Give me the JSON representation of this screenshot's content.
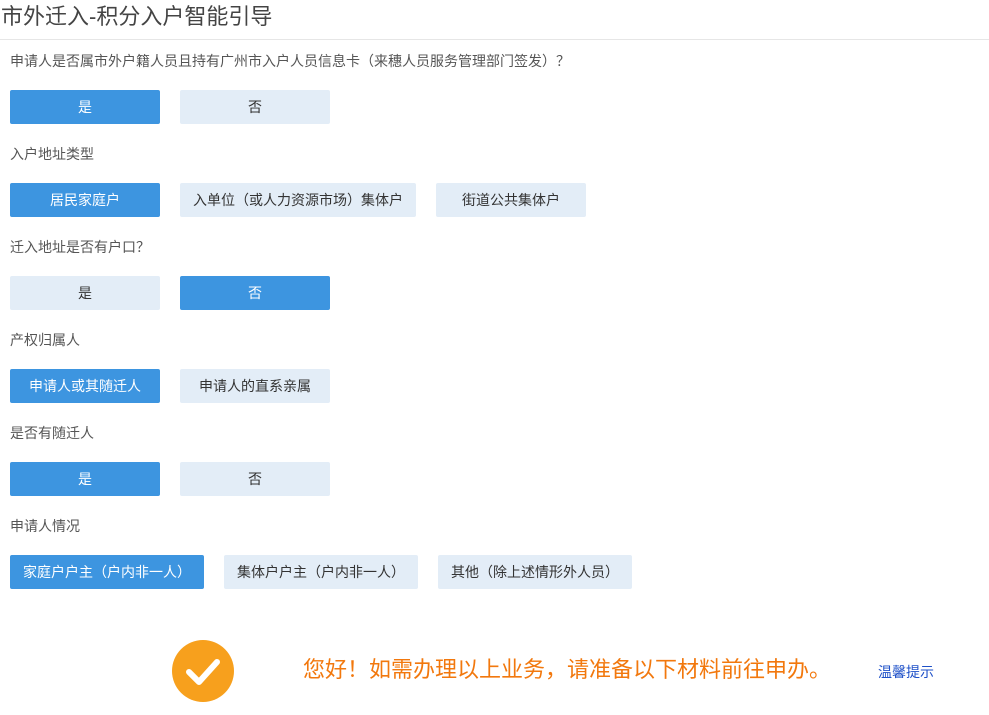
{
  "page": {
    "title": "市外迁入-积分入户智能引导"
  },
  "questions": [
    {
      "label": "申请人是否属市外户籍人员且持有广州市入户人员信息卡（来穗人员服务管理部门签发）？",
      "options": [
        "是",
        "否"
      ],
      "selected": "是"
    },
    {
      "label": "入户地址类型",
      "options": [
        "居民家庭户",
        "入单位（或人力资源市场）集体户",
        "街道公共集体户"
      ],
      "selected": "居民家庭户"
    },
    {
      "label": "迁入地址是否有户口？",
      "options": [
        "是",
        "否"
      ],
      "selected": "否"
    },
    {
      "label": "产权归属人",
      "options": [
        "申请人或其随迁人",
        "申请人的直系亲属"
      ],
      "selected": "申请人或其随迁人"
    },
    {
      "label": "是否有随迁人",
      "options": [
        "是",
        "否"
      ],
      "selected": "是"
    },
    {
      "label": "申请人情况",
      "options": [
        "家庭户户主（户内非一人）",
        "集体户户主（户内非一人）",
        "其他（除上述情形外人员）"
      ],
      "selected": "家庭户户主（户内非一人）"
    }
  ],
  "result": {
    "icon": "check-circle-icon",
    "message": "您好！如需办理以上业务，请准备以下材料前往申办。",
    "tip_link": "温馨提示"
  },
  "colors": {
    "selected_bg": "#3d95e0",
    "unselected_bg": "#e3edf7",
    "result_text": "#f2780d",
    "check_circle": "#f7a01d",
    "link": "#1e50c8"
  }
}
